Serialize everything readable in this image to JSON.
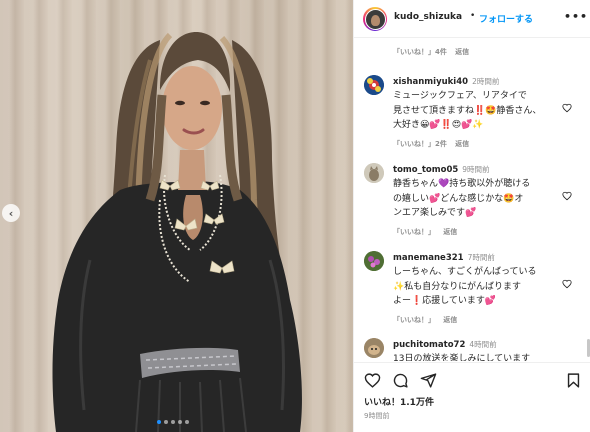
{
  "post": {
    "username": "kudo_shizuka",
    "separator": "•",
    "follow_label": "フォローする",
    "more_label": "•••"
  },
  "photo": {
    "carousel_total": 5,
    "carousel_active": 1
  },
  "top_meta": {
    "like_label": "「いいね！」4件",
    "reply_label": "返信"
  },
  "comments": [
    {
      "username": "xishanmiyuki40",
      "time": "2時間前",
      "text_lines": [
        "ミュージックフェア、リアタイで",
        "見させて頂きますね‼️🤩静香さん、",
        "大好き😀💕‼️😍💕✨"
      ],
      "like_label": "「いいね！」2件",
      "reply_label": "返信"
    },
    {
      "username": "tomo_tomo05",
      "time": "9時間前",
      "text_lines": [
        "静香ちゃん💜持ち歌以外が聴ける",
        "の嬉しい💕どんな感じかな🤩オ",
        "ンエア楽しみです💕"
      ],
      "like_label": "「いいね！」",
      "reply_label": "返信"
    },
    {
      "username": "manemane321",
      "time": "7時間前",
      "text_lines": [
        "しーちゃん、すごくがんばっている",
        "✨私も自分なりにがんばります",
        "よー❗応援しています💕"
      ],
      "like_label": "「いいね！」",
      "reply_label": "返信"
    },
    {
      "username": "puchitomato72",
      "time": "4時間前",
      "text_lines": [
        "13日の放送を楽しみにしています"
      ],
      "like_label": "",
      "reply_label": ""
    }
  ],
  "footer": {
    "likes_text": "いいね！1.1万件",
    "posted_time": "9時間前"
  },
  "colors": {
    "link_blue": "#0095f6",
    "text": "#262626",
    "muted": "#8e8e8e",
    "divider": "#efefef"
  },
  "icons": [
    "more-icon",
    "heart-icon",
    "comment-icon",
    "share-icon",
    "bookmark-icon",
    "chevron-left-icon"
  ]
}
